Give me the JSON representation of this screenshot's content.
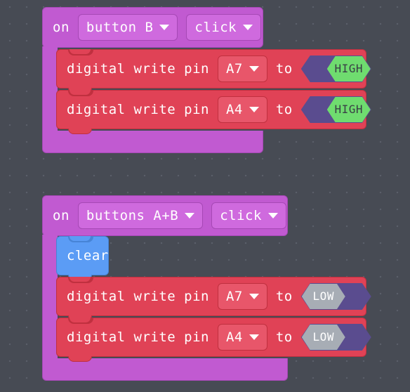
{
  "editor": {
    "background_color": "#474b54",
    "grid_dot_color": "#5b606a"
  },
  "palette": {
    "event_block_color": "#c15ad1",
    "pin_block_color": "#e04256",
    "display_block_color": "#5b9cf5",
    "boolean_field_color": "#5a4c8f",
    "high_knob_color": "#6fdc6f",
    "low_knob_color": "#a7adb5"
  },
  "scripts": [
    {
      "id": "script-on-button-b-click",
      "hat": {
        "prefix_label": "on",
        "source_dropdown": {
          "value": "button B",
          "icon": "chevron-down-icon"
        },
        "event_dropdown": {
          "value": "click",
          "icon": "chevron-down-icon"
        }
      },
      "statements": [
        {
          "kind": "digital-write-pin",
          "color": "#e04256",
          "label": "digital write pin",
          "pin_dropdown": {
            "value": "A7",
            "icon": "chevron-down-icon"
          },
          "to_label": "to",
          "value_toggle": {
            "state": "HIGH",
            "label": "HIGH"
          }
        },
        {
          "kind": "digital-write-pin",
          "color": "#e04256",
          "label": "digital write pin",
          "pin_dropdown": {
            "value": "A4",
            "icon": "chevron-down-icon"
          },
          "to_label": "to",
          "value_toggle": {
            "state": "HIGH",
            "label": "HIGH"
          }
        }
      ]
    },
    {
      "id": "script-on-buttons-ab-click",
      "hat": {
        "prefix_label": "on",
        "source_dropdown": {
          "value": "buttons A+B",
          "icon": "chevron-down-icon"
        },
        "event_dropdown": {
          "value": "click",
          "icon": "chevron-down-icon"
        }
      },
      "statements": [
        {
          "kind": "clear",
          "color": "#5b9cf5",
          "label": "clear"
        },
        {
          "kind": "digital-write-pin",
          "color": "#e04256",
          "label": "digital write pin",
          "pin_dropdown": {
            "value": "A7",
            "icon": "chevron-down-icon"
          },
          "to_label": "to",
          "value_toggle": {
            "state": "LOW",
            "label": "LOW"
          }
        },
        {
          "kind": "digital-write-pin",
          "color": "#e04256",
          "label": "digital write pin",
          "pin_dropdown": {
            "value": "A4",
            "icon": "chevron-down-icon"
          },
          "to_label": "to",
          "value_toggle": {
            "state": "LOW",
            "label": "LOW"
          }
        }
      ]
    }
  ]
}
